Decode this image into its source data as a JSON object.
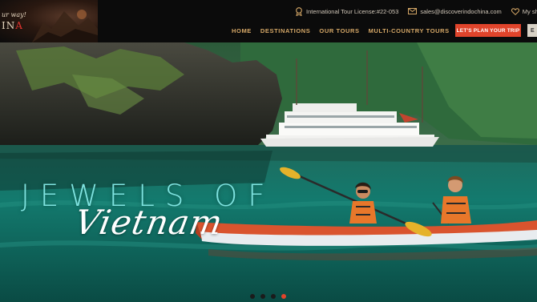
{
  "brand": {
    "tagline": "ur way!",
    "name_main": "IN",
    "name_accent": "A"
  },
  "topbar": {
    "license": "International Tour License:#22-053",
    "email": "sales@discoverindochina.com",
    "shortlist": "My sh"
  },
  "nav": {
    "items": [
      "HOME",
      "DESTINATIONS",
      "OUR TOURS",
      "MULTI-COUNTRY TOURS"
    ],
    "cta": "LET'S PLAN YOUR TRIP",
    "lang": "E"
  },
  "hero": {
    "headline": "JEWELS OF",
    "script": "Vietnam",
    "slides": 4,
    "active_slide": 4
  },
  "colors": {
    "nav_gold": "#d6a867",
    "cta_red": "#e0442b",
    "headline_teal": "#7fe3e0"
  }
}
